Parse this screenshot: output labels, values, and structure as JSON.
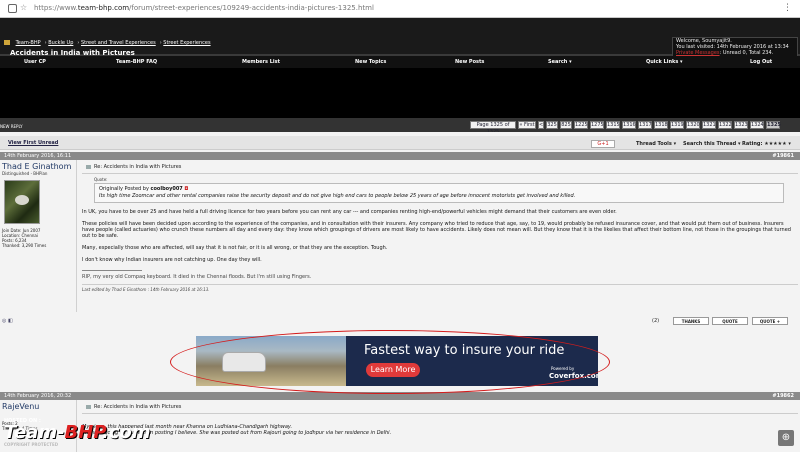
{
  "browser": {
    "url_prefix": "https://www.",
    "url_domain": "team-bhp.com",
    "url_path": "/forum/street-experiences/109249-accidents-india-pictures-1325.html",
    "menu_glyph": "⋮"
  },
  "breadcrumb": [
    "Team-BHP",
    "Buckle Up",
    "Street and Travel Experiences",
    "Street Experiences"
  ],
  "thread_title": "Accidents in India with Pictures",
  "welcome": {
    "line1": "Welcome, Soumyajit9.",
    "line2": "You last visited: 14th February 2016 at 13:34",
    "pm_label": "Private Messages",
    "line3_suffix": ": Unread 0, Total 234."
  },
  "nav": [
    "User CP",
    "Team-BHP FAQ",
    "Members List",
    "New Topics",
    "New Posts",
    "Search ▾",
    "Quick Links ▾",
    "Log Out"
  ],
  "pagination": {
    "label": "Page 1325 of 1325",
    "first": "« First",
    "prev": "<",
    "pages": [
      "325",
      "825",
      "1225",
      "1275",
      "1315",
      "1316",
      "1317",
      "1318",
      "1319",
      "1320",
      "1321",
      "1322",
      "1323",
      "1324",
      "1325"
    ]
  },
  "toolbar": {
    "left_small": "NEW REPLY",
    "view_first_unread": "View First Unread",
    "g_label": "G+1",
    "thread_tools": "Thread Tools ▾",
    "search_thread": "Search this Thread ▾",
    "rating": "Rating: ★★★★★ ▾"
  },
  "posts": [
    {
      "date": "14th February 2016, 16:11",
      "number": "#19861",
      "username": "Thad E Ginathom",
      "user_title": "Distinguished - BHPian",
      "join_date": "Join Date: Jun 2007",
      "location": "Location: Chennai",
      "posts": "Posts: 6,234",
      "thanked": "Thanked: 3,290 Times",
      "title": "Re: Accidents in India with Pictures",
      "quote_label": "Quote:",
      "quote_orig_prefix": "Originally Posted by ",
      "quote_orig_user": "coolboy007",
      "quote_text": "Its high time Zoomcar and other rental companies raise the security deposit and do not give high end cars to people below 25 years of age before innocent motorists get involved and killed.",
      "p1": "In UK, you have to be over 25 and have held a full driving licence for two years before you can rent any car --- and companies renting high-end/powerful vehicles might demand that their customers are even older.",
      "p2": "These policies will have been decided upon according to the experience of the companies, and in consultation with their insurers. Any company who tried to reduce that age, say, to 19, would probably be refused insurance cover, and that would put them out of business. Insurers have people (called actuaries) who crunch these numbers all day and every day: they know which groupings of drivers are most likely to have accidents. Likely does not mean will. But they know that it is the likelies that affect their bottom line, not those in the groupings that turned out to be safe.",
      "p3": "Many, especially those who are affected, will say that it is not fair, or it is all wrong, or that they are the exception. Tough.",
      "p4": "I don't know why Indian insurers are not catching up. One day they will.",
      "signature": "RIP, my very old Compaq keyboard. It died in the Chennai floods. But I'm still using Fingers.",
      "edited": "Last edited by Thad E Ginathom : 14th February 2016 at 16:13.",
      "likes": "(2)",
      "btn_thanks": "THANKS",
      "btn_quote": "QUOTE",
      "btn_quoteplus": "QUOTE +"
    },
    {
      "date": "14th February 2016, 20:32",
      "number": "#19862",
      "username": "RajeVenu",
      "title": "Re: Accidents in India with Pictures",
      "line1": "My niece, this happened last month near Khanna on Ludhiana-Chandigarh highway.",
      "line2": "She was going all leave cum posting I believe. She was posted out from Rajouri going to Jodhpur via her residence in Delhi.",
      "stats_posts": "Posts: 2",
      "stats_thanked": "Thanked: 4 Times"
    }
  ],
  "ad": {
    "tagline": "Fastest way to insure your ride",
    "cta": "Learn More",
    "powered_by": "Powered by",
    "brand": "Coverfox.com"
  },
  "watermark": {
    "hosted_on": "HOSTED ON :",
    "logo_main": "Team-",
    "logo_bhp": "BHP",
    "logo_tld": ".com",
    "copyright": "COPYRIGHT PROTECTED"
  },
  "colors": {
    "header_bg": "#1a1a1a",
    "post_header_bg": "#8a8a8a",
    "content_bg": "#f3f3f3",
    "accent_red": "#d41c1c",
    "ad_bg": "#1c2a4c"
  }
}
